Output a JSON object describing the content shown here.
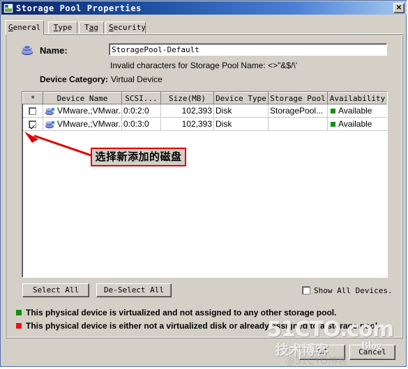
{
  "window": {
    "title": "Storage Pool Properties",
    "icon": "image-icon",
    "close_label": "✕"
  },
  "tabs": [
    {
      "label": "General",
      "mnemonic": "G",
      "active": true
    },
    {
      "label": "Type",
      "mnemonic": "T",
      "active": false
    },
    {
      "label": "Tag",
      "mnemonic": "a",
      "active": false
    },
    {
      "label": "Security",
      "mnemonic": "S",
      "active": false
    }
  ],
  "general": {
    "name_label": "Name:",
    "name_value": "StoragePool-Default",
    "name_placeholder": "",
    "invalid_chars_note": "Invalid characters for Storage Pool Name: <>\"&$/\\'",
    "device_category_label": "Device Category:",
    "device_category_value": "Virtual Device"
  },
  "grid": {
    "columns": [
      "*",
      "Device Name",
      "SCSI...",
      "Size(MB)",
      "Device Type",
      "Storage Pool",
      "Availability"
    ],
    "rows": [
      {
        "selected": false,
        "device_name": "VMware,;VMwar...",
        "scsi": "0:0:2:0",
        "size_mb": "102,393",
        "device_type": "Disk",
        "storage_pool": "StoragePool...",
        "availability": "Available",
        "availability_color": "#109010"
      },
      {
        "selected": true,
        "device_name": "VMware,;VMwar...",
        "scsi": "0:0:3:0",
        "size_mb": "102,393",
        "device_type": "Disk",
        "storage_pool": "",
        "availability": "Available",
        "availability_color": "#109010"
      }
    ]
  },
  "annotation": {
    "text": "选择新添加的磁盘",
    "color": "#e00000"
  },
  "actions": {
    "select_all": "Select All",
    "deselect_all": "De-Select All",
    "show_all_devices": "Show All Devices.",
    "show_all_checked": false,
    "ok": "OK",
    "cancel": "Cancel"
  },
  "legend": [
    {
      "color": "#109010",
      "text": "This physical device is virtualized and not assigned to any other storage pool."
    },
    {
      "color": "#e01818",
      "text": "This physical device is either not a virtualized disk or already assigned to a storage pool."
    }
  ],
  "watermark": {
    "main": "51CTO.com",
    "sub": "技术博客",
    "blog": "Blog",
    "faint": "@51CTO博客"
  }
}
